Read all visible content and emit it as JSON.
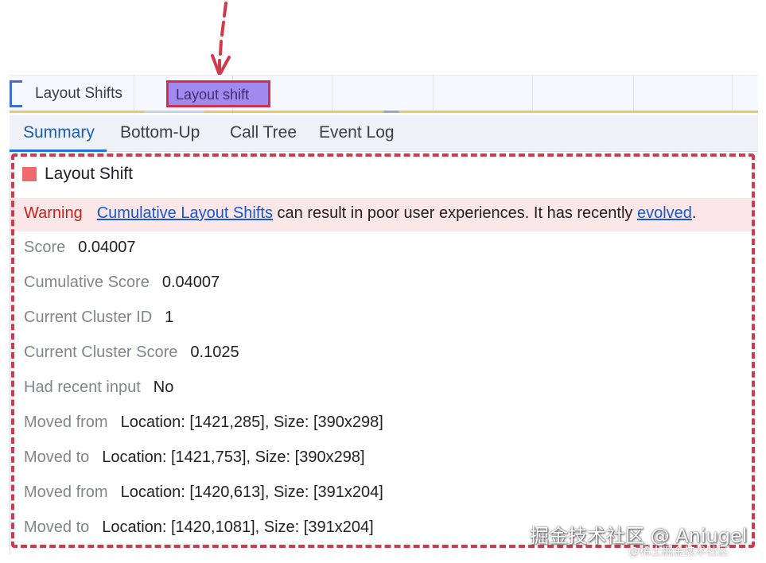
{
  "track": {
    "label": "Layout Shifts",
    "event_label": "Layout shift"
  },
  "tabs": [
    {
      "label": "Summary",
      "active": true
    },
    {
      "label": "Bottom-Up",
      "active": false
    },
    {
      "label": "Call Tree",
      "active": false
    },
    {
      "label": "Event Log",
      "active": false
    }
  ],
  "summary": {
    "title": "Layout Shift",
    "swatch_color": "#ef6b6b",
    "warning": {
      "label": "Warning",
      "link1": "Cumulative Layout Shifts",
      "text": " can result in poor user experiences. It has recently ",
      "link2": "evolved",
      "end": "."
    },
    "rows": [
      {
        "key": "Score",
        "value": "0.04007"
      },
      {
        "key": "Cumulative Score",
        "value": "0.04007"
      },
      {
        "key": "Current Cluster ID",
        "value": "1"
      },
      {
        "key": "Current Cluster Score",
        "value": "0.1025"
      },
      {
        "key": "Had recent input",
        "value": "No"
      },
      {
        "key": "Moved from",
        "value": "Location: [1421,285], Size: [390x298]"
      },
      {
        "key": "Moved to",
        "value": "Location: [1421,753], Size: [390x298]"
      },
      {
        "key": "Moved from",
        "value": "Location: [1420,613], Size: [391x204]"
      },
      {
        "key": "Moved to",
        "value": "Location: [1420,1081], Size: [391x204]"
      }
    ]
  },
  "watermark": {
    "main": "掘金技术社区 @ Aniugel",
    "sub": "@稀土掘金技术社区"
  },
  "colors": {
    "annotation_red": "#d03a4b",
    "event_fill": "#9f8bf0",
    "active_tab": "#1a73e8"
  }
}
